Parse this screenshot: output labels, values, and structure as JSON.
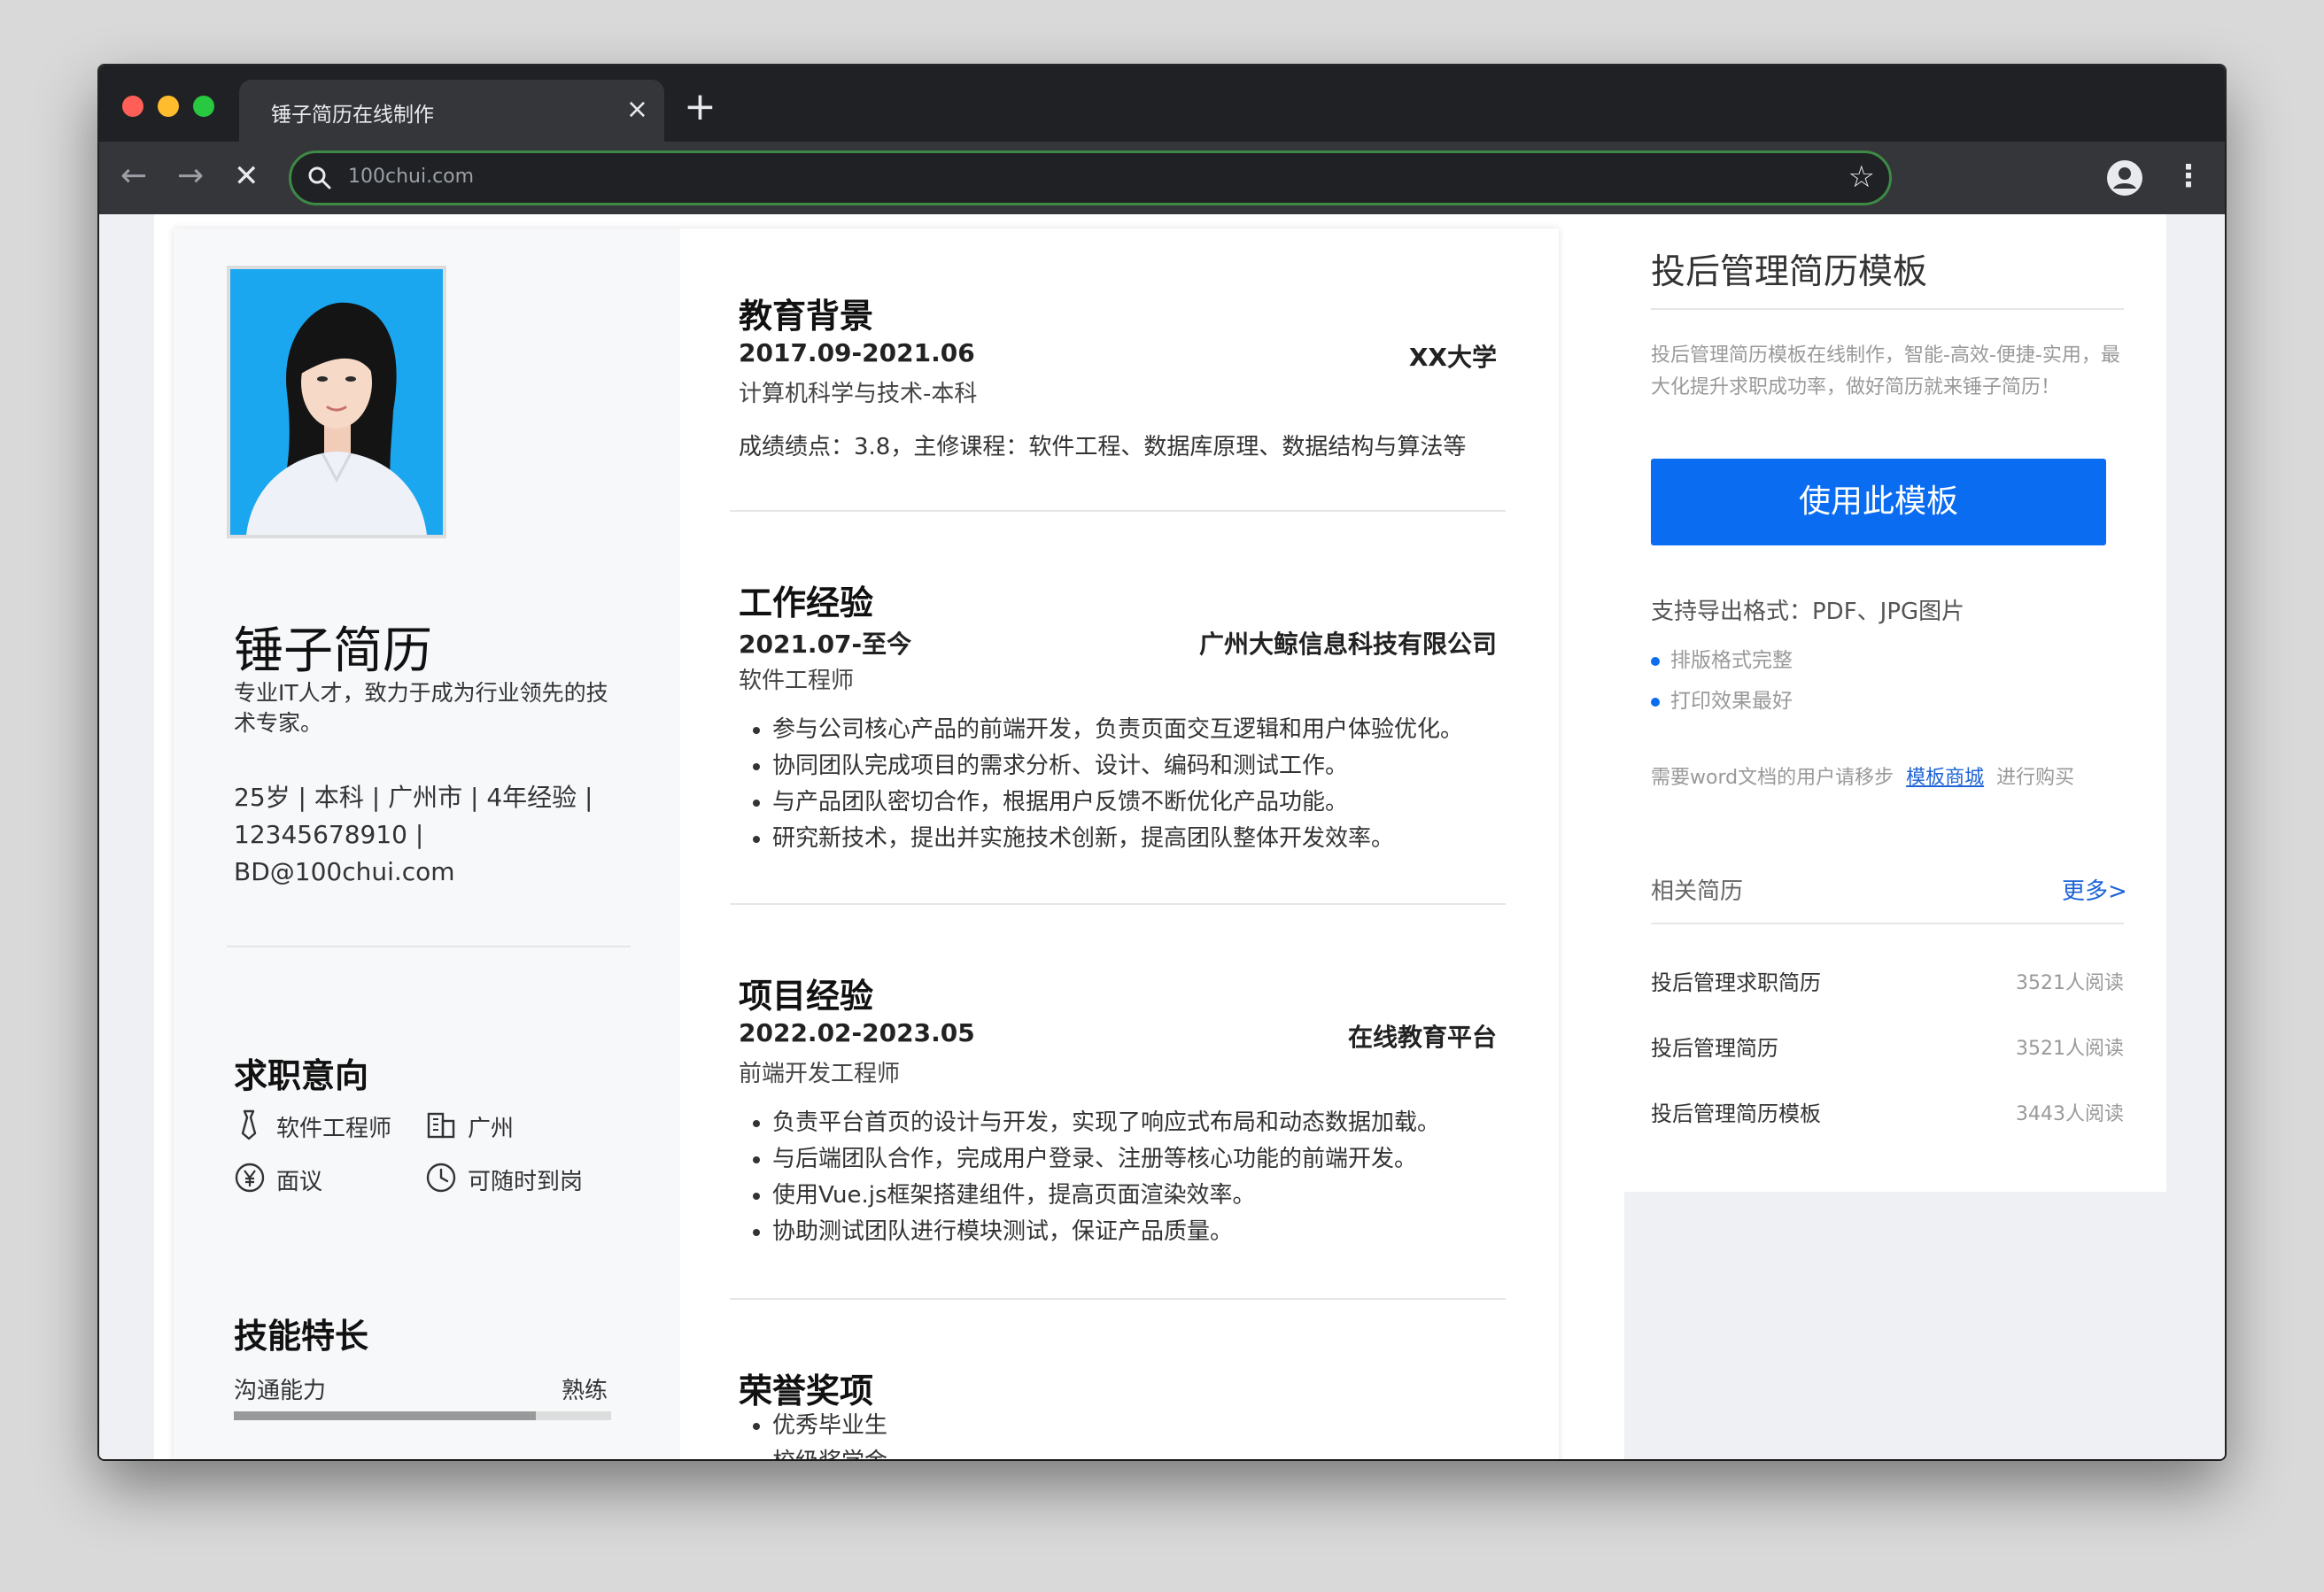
{
  "browser": {
    "tab_title": "锤子简历在线制作",
    "tab_close": "×",
    "new_tab": "+",
    "url": "100chui.com",
    "back": "←",
    "forward": "→",
    "stop": "✕",
    "star": "☆",
    "menu": "⋮"
  },
  "resume": {
    "name": "锤子简历",
    "tagline": "专业IT人才，致力于成为行业领先的技术专家。",
    "info_line1": "25岁 | 本科 | 广州市 | 4年经验 |",
    "info_line2": "12345678910 |",
    "info_line3": "BD@100chui.com",
    "intent_title": "求职意向",
    "intent": {
      "position": "软件工程师",
      "city": "广州",
      "salary": "面议",
      "availability": "可随时到岗"
    },
    "skills_title": "技能特长",
    "skills": [
      {
        "name": "沟通能力",
        "level": "熟练",
        "progress": 0.8
      }
    ],
    "education": {
      "title": "教育背景",
      "date": "2017.09-2021.06",
      "school": "XX大学",
      "major": "计算机科学与技术-本科",
      "detail": "成绩绩点：3.8，主修课程：软件工程、数据库原理、数据结构与算法等"
    },
    "work": {
      "title": "工作经验",
      "date": "2021.07-至今",
      "company": "广州大鲸信息科技有限公司",
      "role": "软件工程师",
      "bullets": [
        "参与公司核心产品的前端开发，负责页面交互逻辑和用户体验优化。",
        "协同团队完成项目的需求分析、设计、编码和测试工作。",
        "与产品团队密切合作，根据用户反馈不断优化产品功能。",
        "研究新技术，提出并实施技术创新，提高团队整体开发效率。"
      ]
    },
    "project": {
      "title": "项目经验",
      "date": "2022.02-2023.05",
      "org": "在线教育平台",
      "role": "前端开发工程师",
      "bullets": [
        "负责平台首页的设计与开发，实现了响应式布局和动态数据加载。",
        "与后端团队合作，完成用户登录、注册等核心功能的前端开发。",
        "使用Vue.js框架搭建组件，提高页面渲染效率。",
        "协助测试团队进行模块测试，保证产品质量。"
      ]
    },
    "honors": {
      "title": "荣誉奖项",
      "items": [
        "优秀毕业生",
        "校级奖学金"
      ]
    }
  },
  "sidebar": {
    "title": "投后管理简历模板",
    "desc": "投后管理简历模板在线制作，智能-高效-便捷-实用，最大化提升求职成功率，做好简历就来锤子简历！",
    "use_button": "使用此模板",
    "export_formats": "支持导出格式：PDF、JPG图片",
    "features": [
      "排版格式完整",
      "打印效果最好"
    ],
    "note_prefix": "需要word文档的用户请移步",
    "note_link": "模板商城",
    "note_suffix": "进行购买",
    "related_title": "相关简历",
    "more": "更多>",
    "related": [
      {
        "name": "投后管理求职简历",
        "count": "3521人阅读"
      },
      {
        "name": "投后管理简历",
        "count": "3521人阅读"
      },
      {
        "name": "投后管理简历模板",
        "count": "3443人阅读"
      }
    ]
  },
  "colors": {
    "accent": "#0a6cf0",
    "link": "#1e64d6",
    "browser_dark": "#202124",
    "omnibox_border": "#3d8a46"
  }
}
